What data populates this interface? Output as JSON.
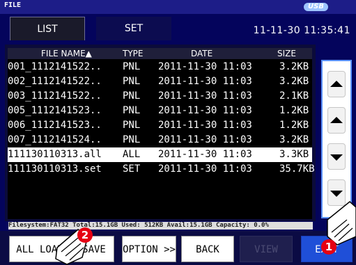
{
  "title": "FILE",
  "usb_badge": "USB",
  "tabs": [
    {
      "label": "LIST"
    },
    {
      "label": "SET"
    }
  ],
  "clock": "11-11-30 11:35:41",
  "table": {
    "columns": [
      "FILE NAME▲",
      "TYPE",
      "DATE",
      "SIZE"
    ],
    "rows": [
      {
        "name": "001_1112141522..",
        "type": "PNL",
        "date": "2011-11-30 11:03",
        "size": "3.2KB"
      },
      {
        "name": "002_1112141522..",
        "type": "PNL",
        "date": "2011-11-30 11:03",
        "size": "3.2KB"
      },
      {
        "name": "003_1112141522..",
        "type": "PNL",
        "date": "2011-11-30 11:03",
        "size": "2.1KB"
      },
      {
        "name": "005_1112141523..",
        "type": "PNL",
        "date": "2011-11-30 11:03",
        "size": "1.2KB"
      },
      {
        "name": "006_1112141523..",
        "type": "PNL",
        "date": "2011-11-30 11:03",
        "size": "1.2KB"
      },
      {
        "name": "007_1112141524..",
        "type": "PNL",
        "date": "2011-11-30 11:03",
        "size": "3.2KB"
      },
      {
        "name": "111130110313.all",
        "type": "ALL",
        "date": "2011-11-30 11:03",
        "size": "3.3KB"
      },
      {
        "name": "111130110313.set",
        "type": "SET",
        "date": "2011-11-30 11:03",
        "size": "35.7KB"
      }
    ],
    "selected_row": 6
  },
  "status": "Filesystem:FAT32 Total:15.1GB Used: 512KB Avail:15.1GB Capacity: 0.0%",
  "buttons": {
    "all_load": "ALL LOAD",
    "save": "SAVE",
    "option": "OPTION >>",
    "back": "BACK",
    "view": "VIEW",
    "exit": "EXIT"
  },
  "callouts": [
    "1",
    "2"
  ],
  "colors": {
    "background": "#04045c",
    "accent": "#1f4fd8",
    "callout": "#e60012"
  }
}
